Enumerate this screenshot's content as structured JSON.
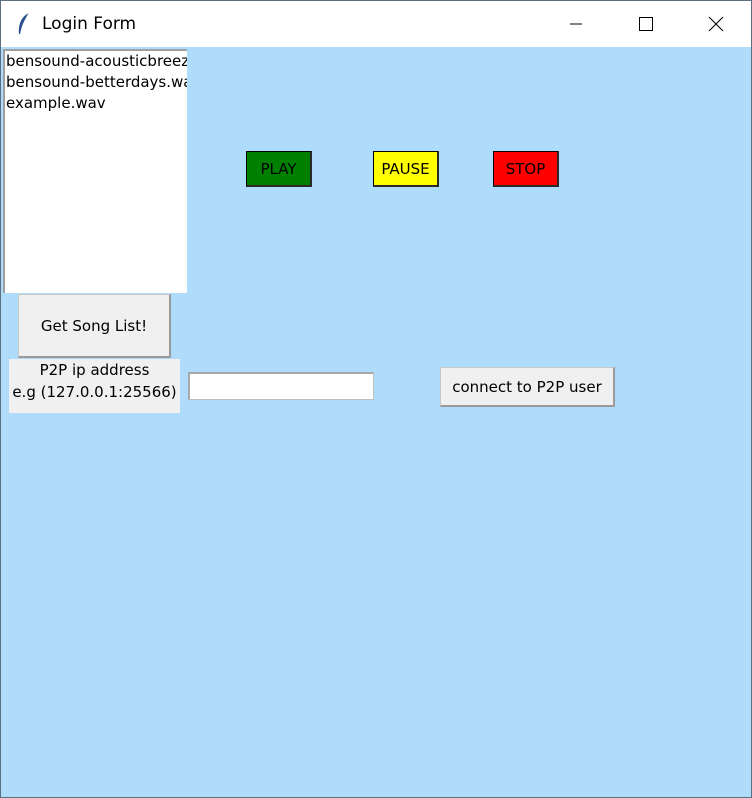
{
  "window": {
    "title": "Login Form",
    "background_color": "#b0dcfc",
    "icon": "feather-icon",
    "controls": [
      "minimize-icon",
      "maximize-icon",
      "close-icon"
    ]
  },
  "song_list": {
    "items": [
      "bensound-acousticbreeze.wav",
      "bensound-betterdays.wav",
      "example.wav"
    ]
  },
  "controls": {
    "play": {
      "label": "PLAY",
      "color": "#008000"
    },
    "pause": {
      "label": "PAUSE",
      "color": "#ffff00"
    },
    "stop": {
      "label": "STOP",
      "color": "#ff0000"
    }
  },
  "get_songs_button": {
    "label": "Get Song List!"
  },
  "p2p": {
    "label_line1": "P2P ip address",
    "label_line2": "e.g (127.0.0.1:25566)",
    "input_value": "",
    "connect_label": "connect to P2P user"
  }
}
